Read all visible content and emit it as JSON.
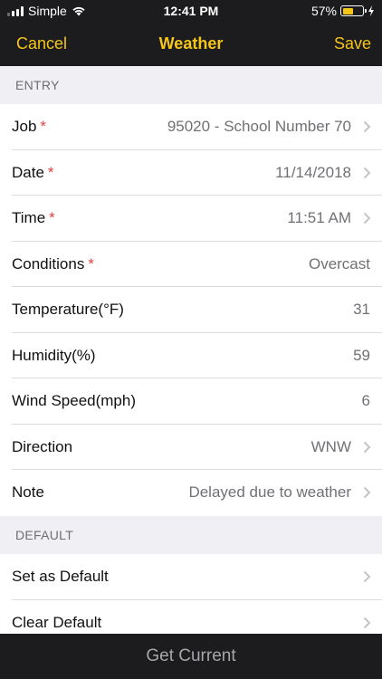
{
  "status_bar": {
    "carrier": "Simple",
    "time": "12:41 PM",
    "battery_percent": "57%",
    "battery_level": 0.57
  },
  "nav": {
    "cancel_label": "Cancel",
    "title": "Weather",
    "save_label": "Save"
  },
  "sections": {
    "entry_header": "ENTRY",
    "default_header": "DEFAULT"
  },
  "entry": {
    "job": {
      "label": "Job",
      "value": "95020 - School Number 70",
      "required": "*"
    },
    "date": {
      "label": "Date",
      "value": "11/14/2018",
      "required": "*"
    },
    "time": {
      "label": "Time",
      "value": "11:51 AM",
      "required": "*"
    },
    "conditions": {
      "label": "Conditions",
      "value": "Overcast",
      "required": "*"
    },
    "temperature": {
      "label": "Temperature(°F)",
      "value": "31"
    },
    "humidity": {
      "label": "Humidity(%)",
      "value": "59"
    },
    "wind_speed": {
      "label": "Wind Speed(mph)",
      "value": "6"
    },
    "direction": {
      "label": "Direction",
      "value": "WNW"
    },
    "note": {
      "label": "Note",
      "value": "Delayed due to weather"
    }
  },
  "defaults": {
    "set_default": "Set as Default",
    "clear_default": "Clear Default"
  },
  "bottom": {
    "get_current_label": "Get Current"
  },
  "colors": {
    "accent": "#f5c518",
    "required": "#e0413f",
    "bar_bg": "#1c1c1e"
  }
}
